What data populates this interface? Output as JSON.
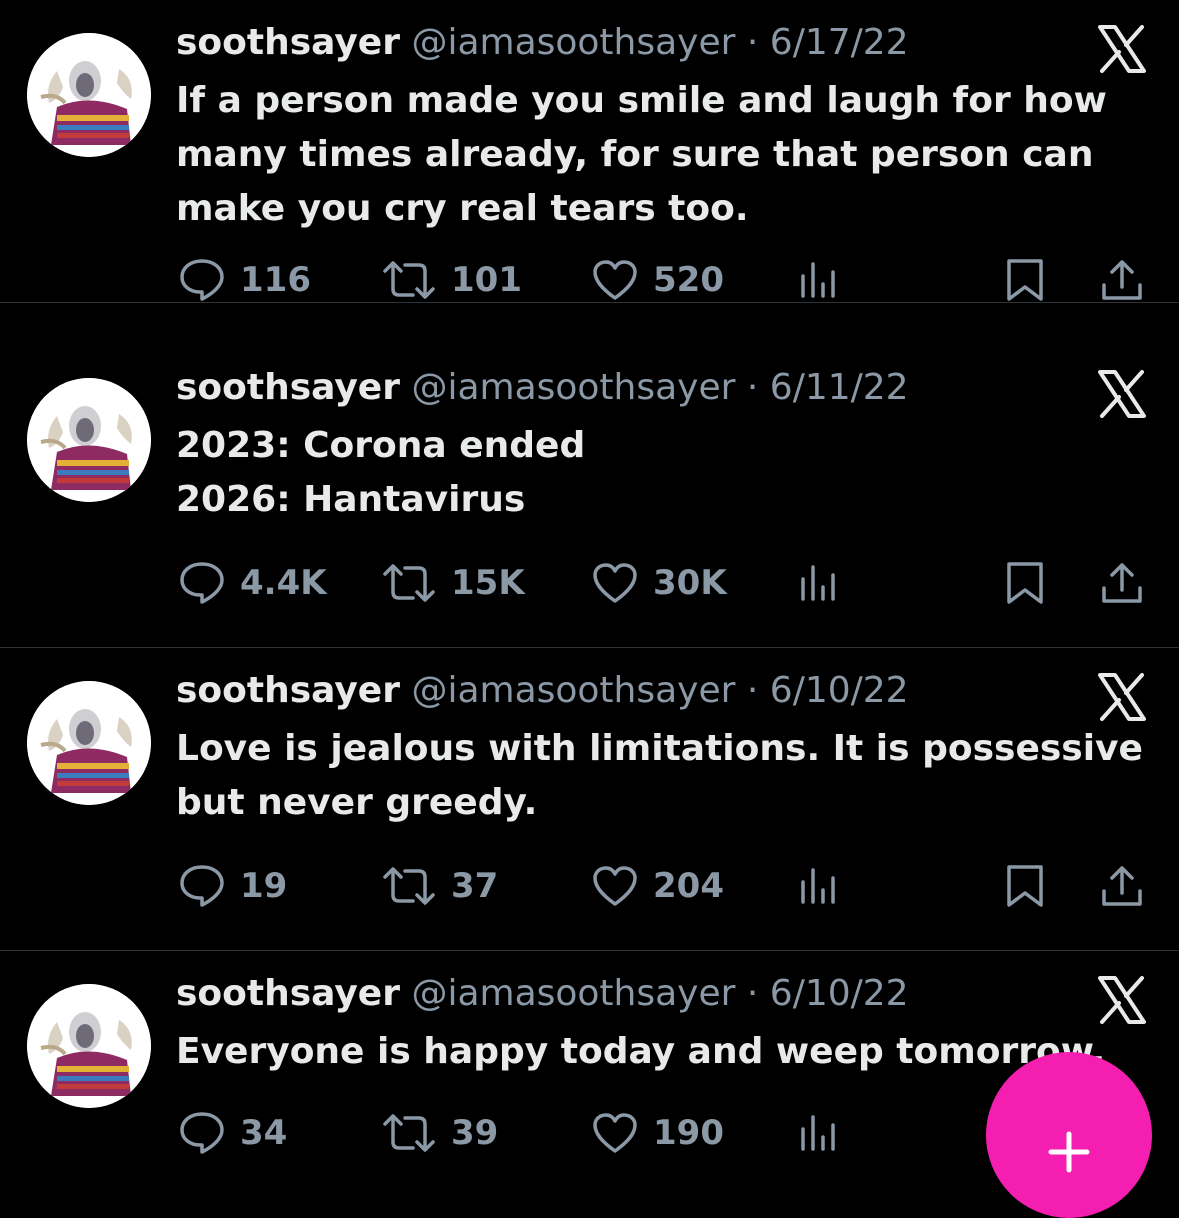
{
  "tweets": [
    {
      "name": "soothsayer",
      "handle": "@iamasoothsayer",
      "separator": "·",
      "date": "6/17/22",
      "text_lines": [
        "If a person made you smile and laugh for how",
        "many times already, for sure that person can",
        "make you cry real tears too."
      ],
      "replies": "116",
      "retweets": "101",
      "likes": "520"
    },
    {
      "name": "soothsayer",
      "handle": "@iamasoothsayer",
      "separator": "·",
      "date": "6/11/22",
      "text_lines": [
        "2023: Corona ended",
        "2026: Hantavirus"
      ],
      "replies": "4.4K",
      "retweets": "15K",
      "likes": "30K"
    },
    {
      "name": "soothsayer",
      "handle": "@iamasoothsayer",
      "separator": "·",
      "date": "6/10/22",
      "text_lines": [
        "Love is jealous with limitations. It is possessive",
        "but never greedy."
      ],
      "replies": "19",
      "retweets": "37",
      "likes": "204"
    },
    {
      "name": "soothsayer",
      "handle": "@iamasoothsayer",
      "separator": "·",
      "date": "6/10/22",
      "text_lines": [
        "Everyone is happy today and weep tomorrow."
      ],
      "replies": "34",
      "retweets": "39",
      "likes": "190"
    }
  ],
  "icons": {
    "x_logo": "x-logo-icon",
    "reply": "reply-icon",
    "retweet": "retweet-icon",
    "like": "heart-icon",
    "views": "views-chart-icon",
    "bookmark": "bookmark-icon",
    "share": "share-icon",
    "compose": "plus-icon"
  },
  "colors": {
    "background": "#000000",
    "primary_text": "#e7e9ea",
    "secondary_text": "#8b98a5",
    "divider": "#2f3336",
    "compose_button": "#f41fb0"
  }
}
